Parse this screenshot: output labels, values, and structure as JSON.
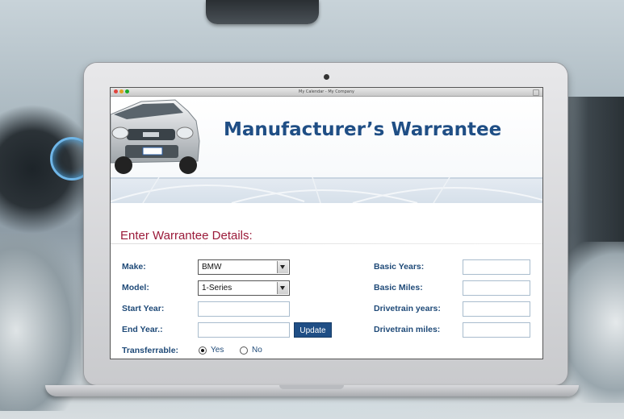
{
  "window": {
    "title": "My Calendar - My Company"
  },
  "header": {
    "title": "Manufacturer’s Warrantee"
  },
  "section": {
    "title": "Enter Warrantee Details:"
  },
  "form": {
    "make_label": "Make:",
    "make_value": "BMW",
    "model_label": "Model:",
    "model_value": "1-Series",
    "start_year_label": "Start Year:",
    "start_year_value": "",
    "end_year_label": "End Year.:",
    "end_year_value": "",
    "update_label": "Update",
    "transferrable_label": "Transferrable:",
    "yes_label": "Yes",
    "no_label": "No",
    "transferrable_selected": "Yes",
    "basic_years_label": "Basic Years:",
    "basic_years_value": "",
    "basic_miles_label": "Basic Miles:",
    "basic_miles_value": "",
    "drivetrain_years_label": "Drivetrain years:",
    "drivetrain_years_value": "",
    "drivetrain_miles_label": "Drivetrain miles:",
    "drivetrain_miles_value": ""
  },
  "colors": {
    "accent": "#1f4e85",
    "section_title": "#9b1b3a",
    "label": "#1f4a78"
  },
  "icons": [
    "close-dot-icon",
    "minimize-dot-icon",
    "zoom-dot-icon",
    "resize-icon",
    "dropdown-arrow-icon",
    "car-image"
  ]
}
